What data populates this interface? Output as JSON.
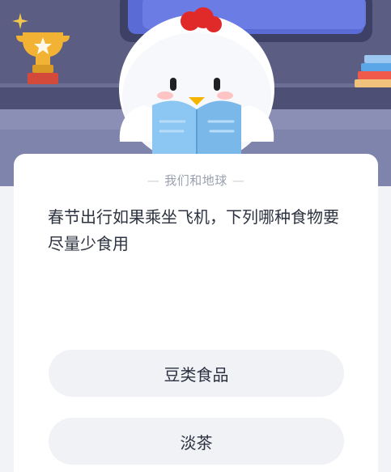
{
  "quiz": {
    "topic": "我们和地球",
    "question": "春节出行如果乘坐飞机，下列哪种食物要尽量少食用",
    "options": [
      {
        "label": "豆类食品"
      },
      {
        "label": "淡茶"
      }
    ]
  },
  "colors": {
    "background": "#f2f3f7",
    "card": "#ffffff",
    "option_bg": "#f1f2f6",
    "hero_wall": "#5b5d82",
    "hero_desk": "#8b8fb6",
    "accent_red": "#e02a2a",
    "trophy_gold": "#f2b233"
  },
  "icons": {
    "mascot": "chicken-reading-book-illustration",
    "trophy": "trophy-icon",
    "books": "books-stack-icon",
    "sparkle": "sparkle-icon"
  }
}
